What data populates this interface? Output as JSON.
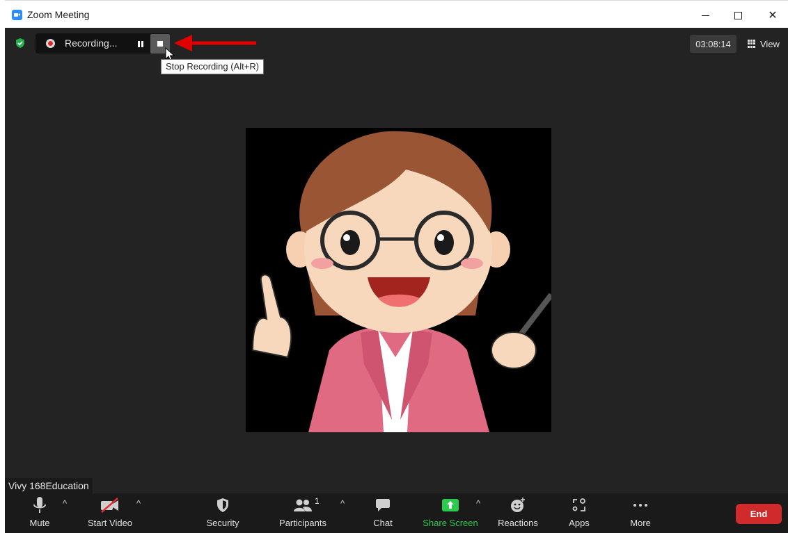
{
  "window": {
    "title": "Zoom Meeting"
  },
  "recording": {
    "status_text": "Recording...",
    "tooltip": "Stop Recording (Alt+R)"
  },
  "header": {
    "timer": "03:08:14",
    "view_label": "View"
  },
  "participant": {
    "name": "Vivy 168Education"
  },
  "toolbar": {
    "mute_label": "Mute",
    "start_video_label": "Start Video",
    "security_label": "Security",
    "participants_label": "Participants",
    "participants_count": "1",
    "chat_label": "Chat",
    "share_screen_label": "Share Screen",
    "reactions_label": "Reactions",
    "apps_label": "Apps",
    "more_label": "More",
    "end_label": "End"
  },
  "colors": {
    "stage_bg": "#232323",
    "toolbar_bg": "#1a1a1a",
    "accent_green": "#2cc94f",
    "end_red": "#d12a2a",
    "annotation_arrow": "#e00000"
  }
}
